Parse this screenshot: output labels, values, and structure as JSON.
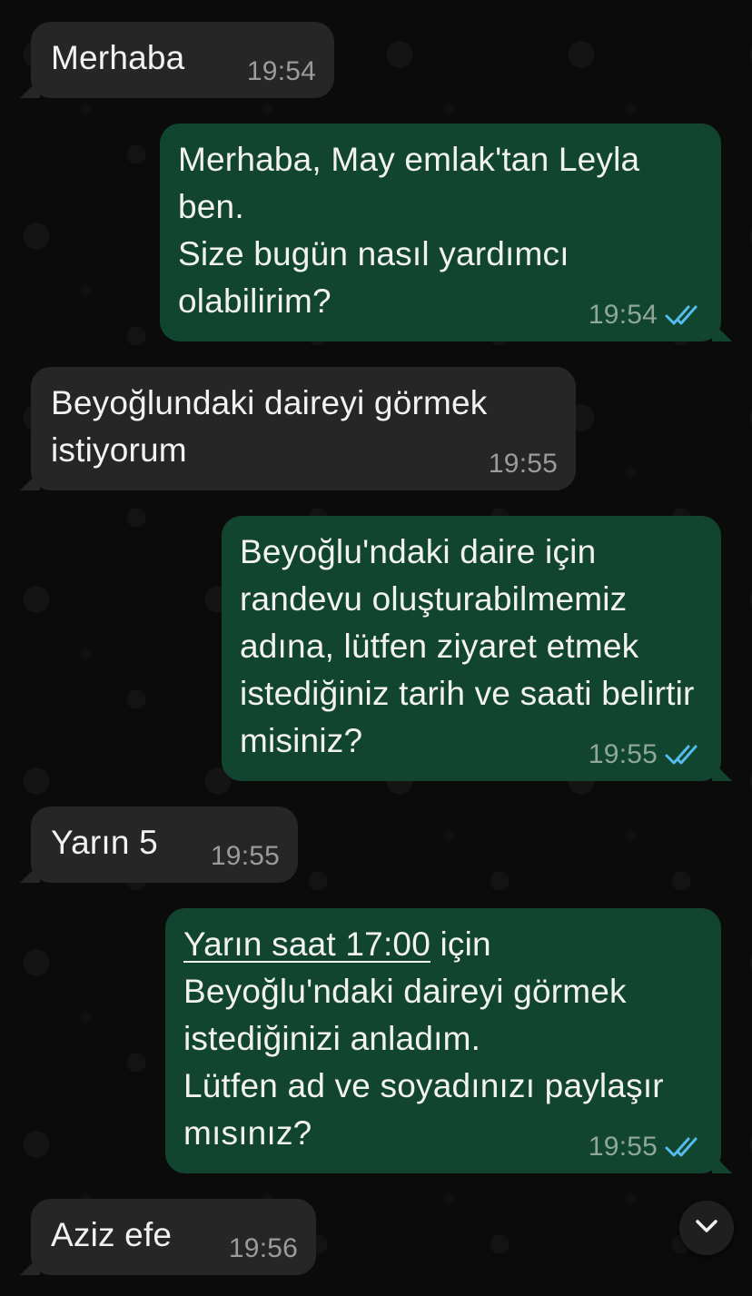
{
  "messages": [
    {
      "direction": "in",
      "text": "Merhaba",
      "time": "19:54"
    },
    {
      "direction": "out",
      "text": "Merhaba, May emlak'tan Leyla ben.\nSize bugün nasıl yardımcı olabilirim?",
      "time": "19:54"
    },
    {
      "direction": "in",
      "text": "Beyoğlundaki daireyi görmek istiyorum",
      "time": "19:55"
    },
    {
      "direction": "out",
      "text": "Beyoğlu'ndaki daire için randevu oluşturabilmemiz adına, lütfen ziyaret etmek istediğiniz tarih ve saati belirtir misiniz?",
      "time": "19:55"
    },
    {
      "direction": "in",
      "text": "Yarın 5",
      "time": "19:55"
    },
    {
      "direction": "out",
      "link_text": "Yarın saat 17:00",
      "text_after_link": " için Beyoğlu'ndaki daireyi görmek istediğinizi anladım.\nLütfen ad ve soyadınızı paylaşır mısınız?",
      "time": "19:55"
    },
    {
      "direction": "in",
      "text": "Aziz efe",
      "time": "19:56"
    }
  ],
  "colors": {
    "incoming_bubble": "#262626",
    "outgoing_bubble": "#12452f",
    "read_ticks": "#53bdeb",
    "background": "#0b0b0b"
  },
  "icons": {
    "read_receipt": "double-check-icon",
    "scroll_down": "chevron-down-icon"
  }
}
